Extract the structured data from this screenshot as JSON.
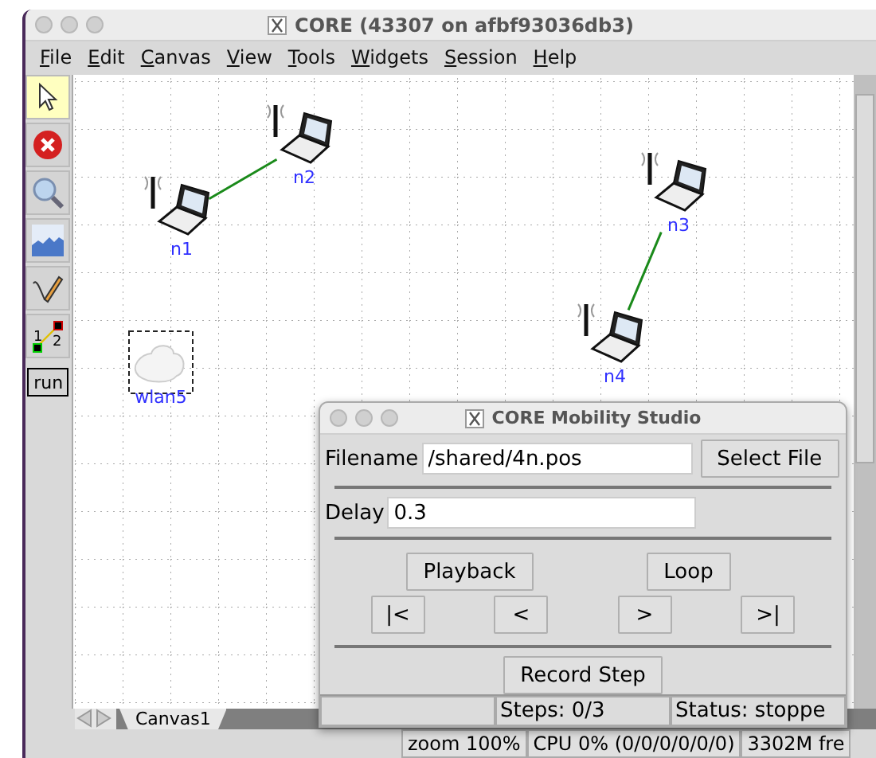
{
  "window": {
    "title": "CORE (43307 on afbf93036db3)"
  },
  "menu": [
    "File",
    "Edit",
    "Canvas",
    "View",
    "Tools",
    "Widgets",
    "Session",
    "Help"
  ],
  "tools": [
    {
      "kind": "select",
      "selected": true
    },
    {
      "kind": "stop",
      "selected": false
    },
    {
      "kind": "zoom",
      "selected": false
    },
    {
      "kind": "plot",
      "selected": false
    },
    {
      "kind": "draw",
      "selected": false
    },
    {
      "kind": "link",
      "selected": false,
      "labels": [
        "1",
        "2"
      ]
    },
    {
      "kind": "run",
      "selected": false,
      "label": "run"
    }
  ],
  "canvas": {
    "nodes": [
      {
        "kind": "laptop",
        "label": "n1"
      },
      {
        "kind": "laptop",
        "label": "n2"
      },
      {
        "kind": "laptop",
        "label": "n3"
      },
      {
        "kind": "laptop",
        "label": "n4"
      },
      {
        "kind": "wlan",
        "label": "wlan5"
      }
    ]
  },
  "canvas_tabs": [
    {
      "label": "Canvas1",
      "selected": true
    }
  ],
  "status_bar": [
    "zoom 100%",
    "CPU 0% (0/0/0/0/0/0)",
    "3302M fre"
  ],
  "dialog": {
    "title": "CORE Mobility Studio",
    "filename": {
      "label": "Filename",
      "value": "/shared/4n.pos"
    },
    "select_button": "Select File",
    "delay": {
      "label": "Delay",
      "value": "0.3"
    },
    "buttons": [
      "Playback",
      "Loop"
    ],
    "nav_buttons": [
      "|<",
      "<",
      ">",
      ">|"
    ],
    "record_button": "Record Step",
    "status": [
      "Steps: 0/3",
      "Status: stoppe"
    ]
  }
}
